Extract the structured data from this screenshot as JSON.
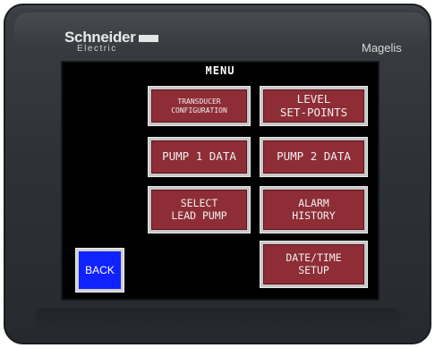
{
  "device": {
    "brand_name": "Schneider",
    "brand_sub": "Electric",
    "model": "Magelis"
  },
  "screen": {
    "title": "MENU",
    "buttons": [
      {
        "id": "transducer",
        "label": "TRANSDUCER\nCONFIGURATION"
      },
      {
        "id": "level",
        "label": "LEVEL\nSET-POINTS"
      },
      {
        "id": "pump1",
        "label": "PUMP 1 DATA"
      },
      {
        "id": "pump2",
        "label": "PUMP 2 DATA"
      },
      {
        "id": "lead",
        "label": "SELECT\nLEAD PUMP"
      },
      {
        "id": "alarm",
        "label": "ALARM\nHISTORY"
      },
      {
        "id": "datetime",
        "label": "DATE/TIME\nSETUP"
      }
    ],
    "back_label": "BACK"
  },
  "colors": {
    "button_fill": "#8e2d36",
    "back_fill": "#1022ff",
    "screen_bg": "#000000",
    "bezel": "#2e3236"
  }
}
